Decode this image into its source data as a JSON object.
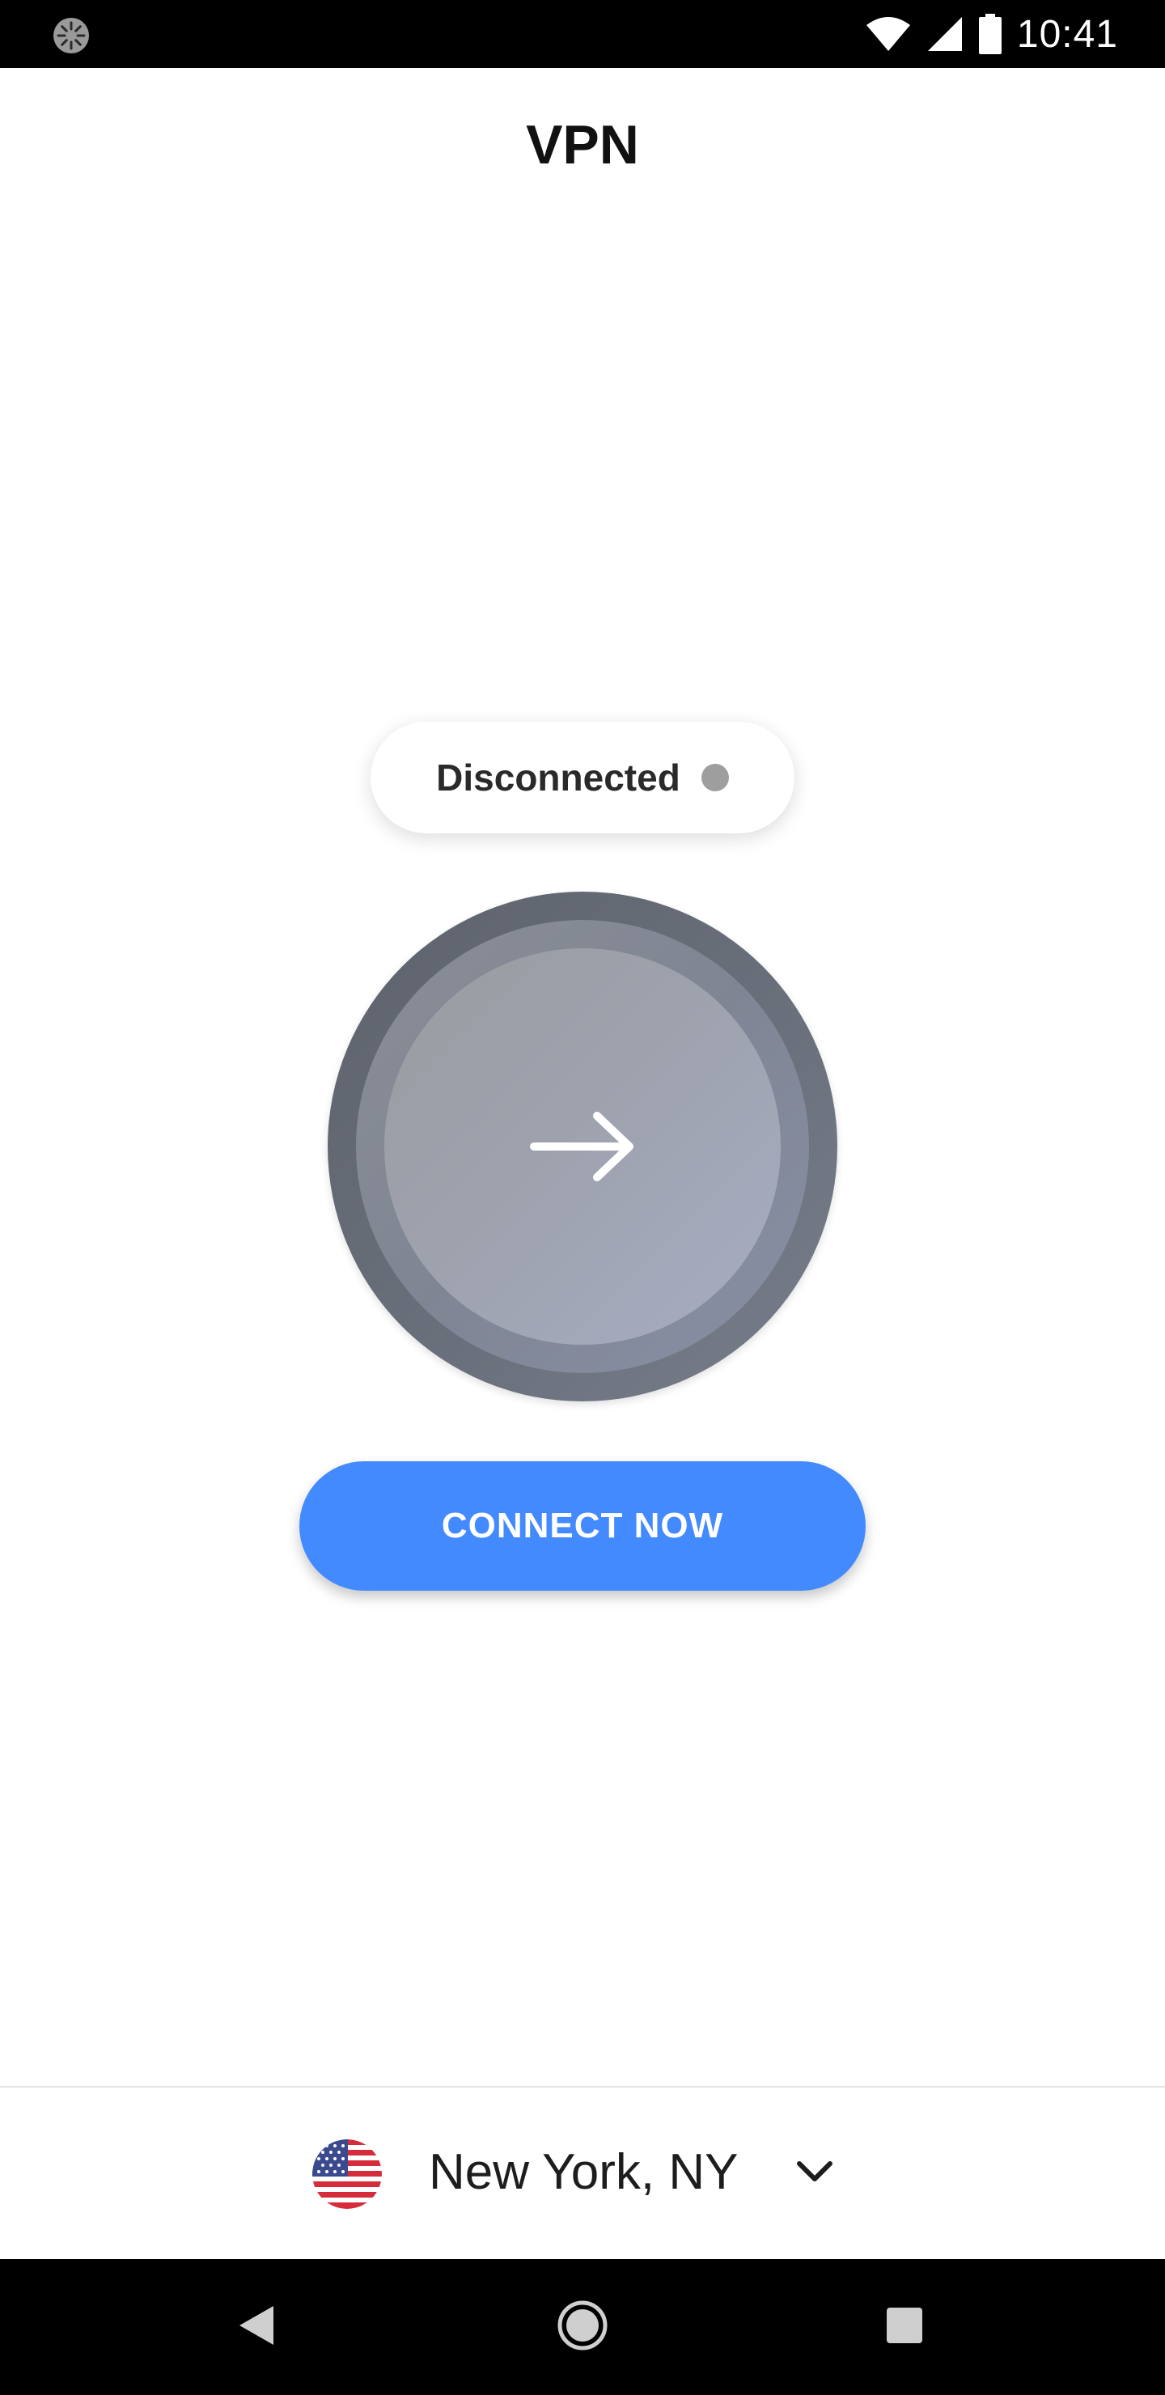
{
  "status_bar": {
    "time": "10:41",
    "icons": [
      "loading-spinner-icon",
      "wifi-icon",
      "cellular-signal-icon",
      "battery-icon"
    ]
  },
  "header": {
    "title": "VPN"
  },
  "connection": {
    "status_text": "Disconnected",
    "status_color": "#9e9e9e",
    "power_icon": "arrow-right-icon"
  },
  "actions": {
    "connect_label": "CONNECT NOW",
    "accent_color": "#448aff"
  },
  "location": {
    "name": "New York, NY",
    "flag_icon": "us-flag-icon",
    "chevron_icon": "chevron-down-icon"
  },
  "nav_bar": {
    "icons": [
      "back-icon",
      "home-icon",
      "recents-icon"
    ]
  }
}
